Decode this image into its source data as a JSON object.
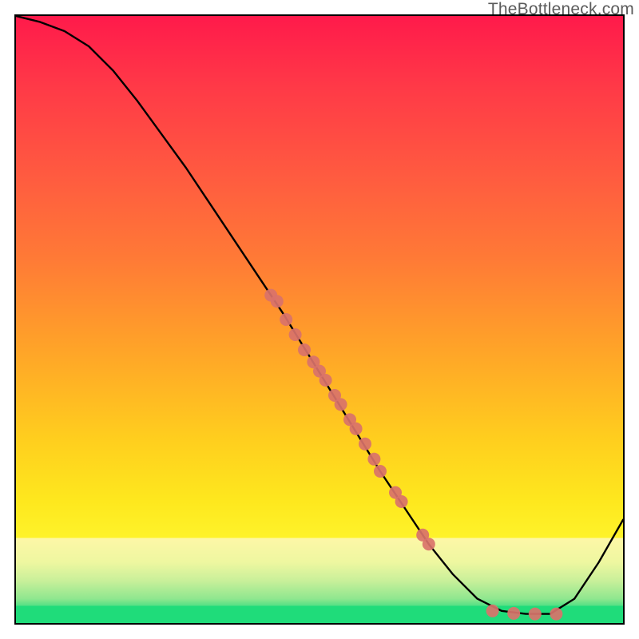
{
  "watermark": "TheBottleneck.com",
  "chart_data": {
    "type": "line",
    "title": "",
    "xlabel": "",
    "ylabel": "",
    "xlim": [
      0,
      100
    ],
    "ylim": [
      0,
      100
    ],
    "grid": false,
    "legend": false,
    "series": [
      {
        "name": "bottleneck-curve",
        "comment": "Black curve. Values are percentages of plot area; y=0 is bottom (green), y=100 is top (red).",
        "x": [
          0,
          4,
          8,
          12,
          16,
          20,
          24,
          28,
          32,
          36,
          40,
          44,
          48,
          52,
          56,
          60,
          64,
          68,
          72,
          76,
          80,
          84,
          88,
          92,
          96,
          100
        ],
        "y": [
          100,
          99,
          97.5,
          95,
          91,
          86,
          80.5,
          75,
          69,
          63,
          57,
          51,
          44.5,
          38,
          31.5,
          25,
          19,
          13,
          8,
          4,
          2,
          1.5,
          1.5,
          4,
          10,
          17
        ]
      }
    ],
    "scatter": {
      "name": "sample-points",
      "comment": "Salmon dots lying on or near the curve. Same coordinate convention as the curve.",
      "color": "#d9726a",
      "radius_px": 8,
      "points": [
        {
          "x": 42.0,
          "y": 54.0
        },
        {
          "x": 43.0,
          "y": 53.0
        },
        {
          "x": 44.5,
          "y": 50.0
        },
        {
          "x": 46.0,
          "y": 47.5
        },
        {
          "x": 47.5,
          "y": 45.0
        },
        {
          "x": 49.0,
          "y": 43.0
        },
        {
          "x": 50.0,
          "y": 41.5
        },
        {
          "x": 51.0,
          "y": 40.0
        },
        {
          "x": 52.5,
          "y": 37.5
        },
        {
          "x": 53.5,
          "y": 36.0
        },
        {
          "x": 55.0,
          "y": 33.5
        },
        {
          "x": 56.0,
          "y": 32.0
        },
        {
          "x": 57.5,
          "y": 29.5
        },
        {
          "x": 59.0,
          "y": 27.0
        },
        {
          "x": 60.0,
          "y": 25.0
        },
        {
          "x": 62.5,
          "y": 21.5
        },
        {
          "x": 63.5,
          "y": 20.0
        },
        {
          "x": 67.0,
          "y": 14.5
        },
        {
          "x": 68.0,
          "y": 13.0
        },
        {
          "x": 78.5,
          "y": 2.0
        },
        {
          "x": 82.0,
          "y": 1.6
        },
        {
          "x": 85.5,
          "y": 1.5
        },
        {
          "x": 89.0,
          "y": 1.5
        }
      ]
    }
  }
}
